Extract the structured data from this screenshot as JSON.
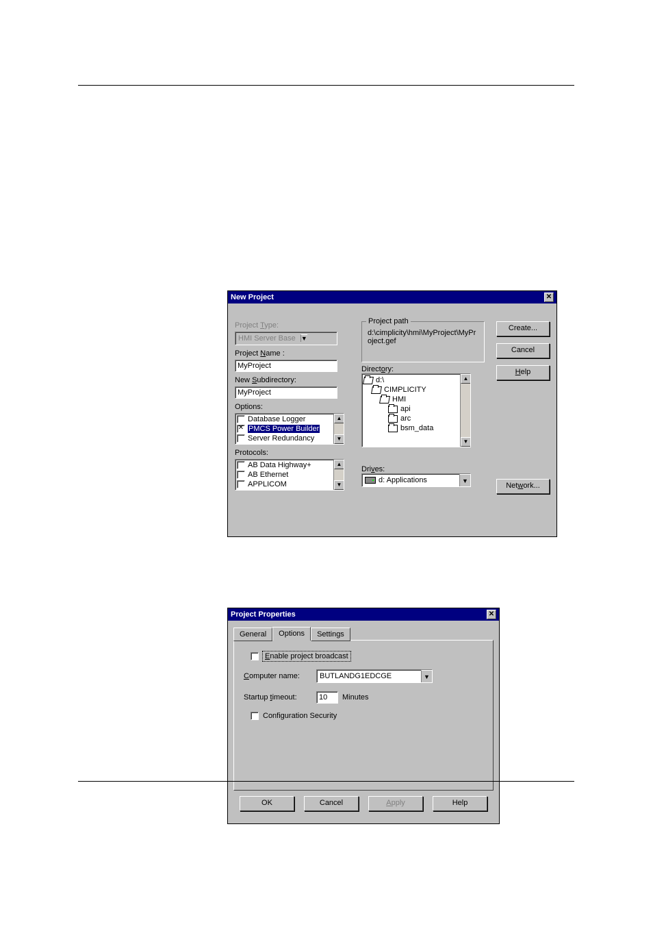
{
  "dialog1": {
    "title": "New Project",
    "project_type_label": "Project Type:",
    "project_type_value": "HMI Server Base",
    "project_name_label": "Project Name :",
    "project_name_value": "MyProject",
    "new_subdir_label": "New Subdirectory:",
    "new_subdir_value": "MyProject",
    "options_label": "Options:",
    "options": [
      {
        "label": "Database Logger",
        "checked": false
      },
      {
        "label": "PMCS Power Builder",
        "checked": true
      },
      {
        "label": "Server Redundancy",
        "checked": false
      }
    ],
    "protocols_label": "Protocols:",
    "protocols": [
      {
        "label": "AB Data Highway+",
        "checked": false
      },
      {
        "label": "AB Ethernet",
        "checked": false
      },
      {
        "label": "APPLICOM",
        "checked": false
      }
    ],
    "project_path_label": "Project path",
    "project_path_value": "d:\\cimplicity\\hmi\\MyProject\\MyProject.gef",
    "directory_label": "Directory:",
    "directory_tree": [
      {
        "name": "d:\\",
        "indent": 0,
        "open": true
      },
      {
        "name": "CIMPLICITY",
        "indent": 1,
        "open": true
      },
      {
        "name": "HMI",
        "indent": 2,
        "open": true
      },
      {
        "name": "api",
        "indent": 3,
        "open": false
      },
      {
        "name": "arc",
        "indent": 3,
        "open": false
      },
      {
        "name": "bsm_data",
        "indent": 3,
        "open": false
      }
    ],
    "drives_label": "Drives:",
    "drives_value": "d: Applications",
    "btn_create": "Create...",
    "btn_cancel": "Cancel",
    "btn_help": "Help",
    "btn_network": "Network..."
  },
  "dialog2": {
    "title": "Project Properties",
    "tabs": {
      "general": "General",
      "options": "Options",
      "settings": "Settings"
    },
    "active_tab": "options",
    "enable_broadcast_label": "Enable project broadcast",
    "enable_broadcast_checked": false,
    "computer_name_label": "Computer name:",
    "computer_name_value": "BUTLANDG1EDCGE",
    "startup_timeout_label": "Startup timeout:",
    "startup_timeout_value": "10",
    "startup_timeout_unit": "Minutes",
    "config_security_label": "Configuration Security",
    "config_security_checked": false,
    "btn_ok": "OK",
    "btn_cancel": "Cancel",
    "btn_apply": "Apply",
    "btn_help": "Help"
  }
}
